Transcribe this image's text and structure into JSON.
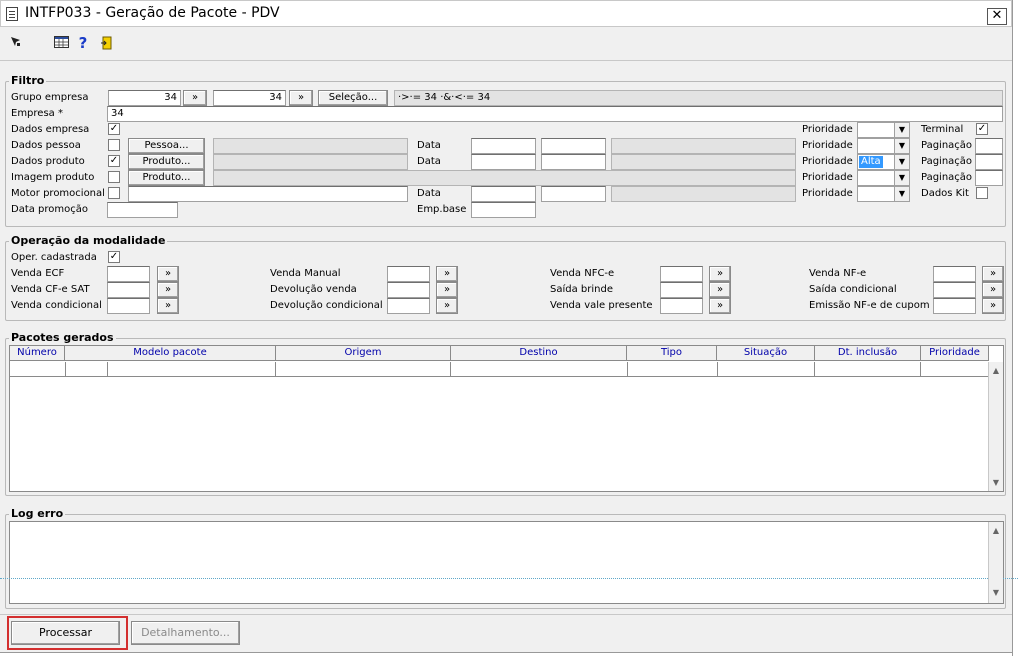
{
  "window": {
    "title": "INTFP033 - Geração de Pacote - PDV",
    "close": "✕"
  },
  "toolbar": {
    "icons": [
      "cursor-icon",
      "calendar-grid-icon",
      "help-icon",
      "exit-door-icon"
    ],
    "help_glyph": "?"
  },
  "filtro": {
    "title": "Filtro",
    "grupo_empresa": {
      "label": "Grupo empresa",
      "from": "34",
      "to": "34",
      "next1": "»",
      "next2": "»",
      "selecao_btn": "Seleção...",
      "expression": "·>·= 34 ·&·<·= 34"
    },
    "empresa": {
      "label": "Empresa *",
      "value": "34"
    },
    "dados_empresa": {
      "label": "Dados empresa",
      "checked": "✓"
    },
    "dados_pessoa": {
      "label": "Dados pessoa",
      "btn": "Pessoa..."
    },
    "dados_produto": {
      "label": "Dados produto",
      "checked": "✓",
      "btn": "Produto..."
    },
    "imagem_produto": {
      "label": "Imagem produto",
      "btn": "Produto..."
    },
    "motor_promocional": {
      "label": "Motor promocional"
    },
    "data_promocao": {
      "label": "Data promoção"
    },
    "data_label": "Data",
    "emp_base_label": "Emp.base",
    "prioridade_label": "Prioridade",
    "prioridade_alta": "Alta",
    "terminal": {
      "label": "Terminal",
      "checked": "✓"
    },
    "paginacao_label": "Paginação",
    "dados_kit": {
      "label": "Dados Kit"
    }
  },
  "operacao": {
    "title": "Operação da modalidade",
    "oper_cadastrada": {
      "label": "Oper. cadastrada",
      "checked": "✓"
    },
    "btn": "»",
    "col1": [
      "Venda ECF",
      "Venda CF-e SAT",
      "Venda condicional"
    ],
    "col2": [
      "Venda Manual",
      "Devolução venda",
      "Devolução condicional"
    ],
    "col3": [
      "Venda NFC-e",
      "Saída brinde",
      "Venda vale presente"
    ],
    "col4": [
      "Venda NF-e",
      "Saída condicional",
      "Emissão NF-e de cupom"
    ]
  },
  "pacotes": {
    "title": "Pacotes gerados",
    "columns": [
      "Número",
      "Modelo pacote",
      "Origem",
      "Destino",
      "Tipo",
      "Situação",
      "Dt. inclusão",
      "Prioridade"
    ]
  },
  "log": {
    "title": "Log erro"
  },
  "footer": {
    "processar": "Processar",
    "detalhamento": "Detalhamento..."
  },
  "colors": {
    "highlight_border": "#d32f2f",
    "header_text": "#0000aa",
    "selection": "#3399ff"
  }
}
